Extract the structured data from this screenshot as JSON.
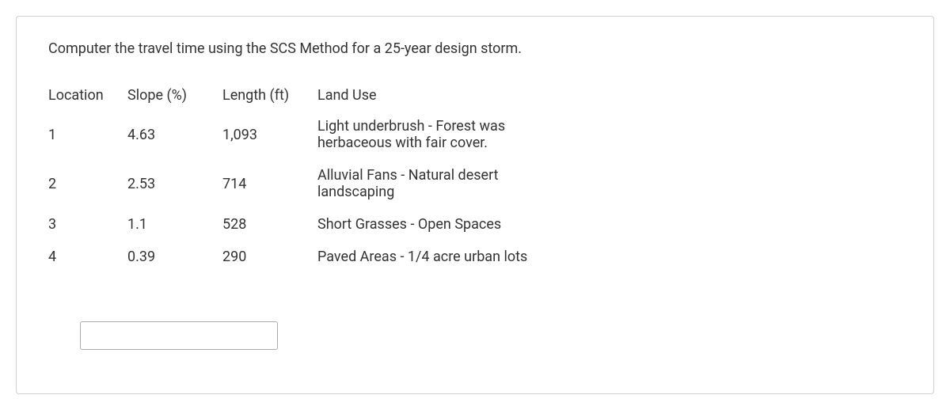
{
  "prompt": "Computer the travel time using the SCS Method for a 25-year design storm.",
  "table": {
    "headers": {
      "location": "Location",
      "slope": "Slope (%)",
      "length": "Length (ft)",
      "landuse": "Land Use"
    },
    "rows": [
      {
        "location": "1",
        "slope": "4.63",
        "length": "1,093",
        "landuse": "Light underbrush - Forest was herbaceous with fair cover."
      },
      {
        "location": "2",
        "slope": "2.53",
        "length": "714",
        "landuse": "Alluvial Fans - Natural desert landscaping"
      },
      {
        "location": "3",
        "slope": "1.1",
        "length": "528",
        "landuse": "Short Grasses - Open Spaces"
      },
      {
        "location": "4",
        "slope": "0.39",
        "length": "290",
        "landuse": "Paved Areas - 1/4 acre urban lots"
      }
    ]
  },
  "input": {
    "value": "",
    "placeholder": ""
  }
}
